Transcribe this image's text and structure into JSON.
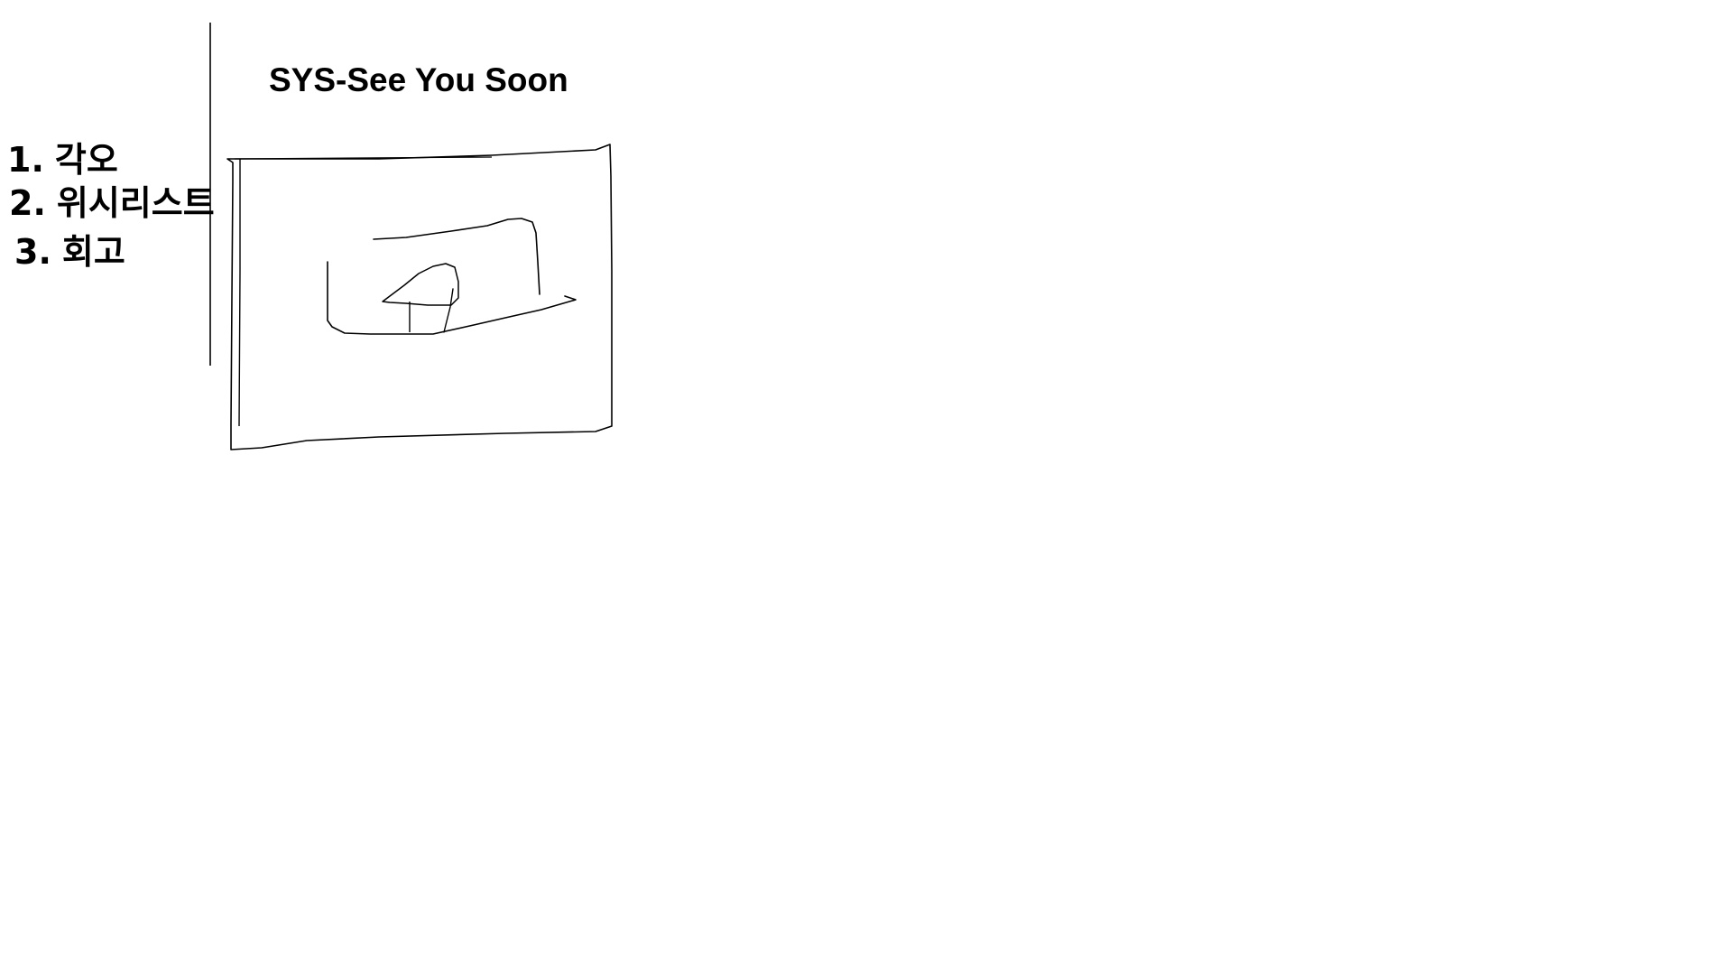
{
  "header": {
    "title": "SYS-See You Soon"
  },
  "menu": {
    "items": [
      {
        "number": "1.",
        "label": "각오"
      },
      {
        "number": "2.",
        "label": "위시리스트"
      },
      {
        "number": "3.",
        "label": "회고"
      }
    ]
  },
  "colors": {
    "stroke": "#000000",
    "background": "#ffffff"
  }
}
